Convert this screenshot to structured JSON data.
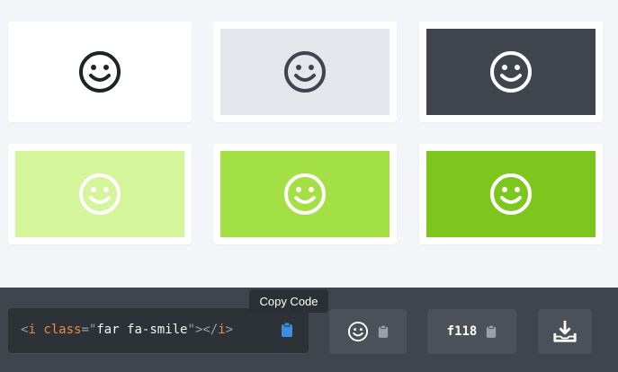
{
  "icon": {
    "name": "smile-icon",
    "html_code_parts": {
      "open": "<",
      "tag": "i",
      "space": " ",
      "attr": "class",
      "eq": "=",
      "q1": "\"",
      "value": "far fa-smile",
      "q2": "\"",
      "close": "></",
      "tag2": "i",
      "end": ">"
    },
    "unicode": "f118"
  },
  "tooltip": {
    "text": "Copy Code"
  },
  "swatches": [
    {
      "bg": "#ffffff",
      "icon": "#1f2328"
    },
    {
      "bg": "#e5e7ec",
      "icon": "#3f444d"
    },
    {
      "bg": "#3f444d",
      "icon": "#ffffff"
    },
    {
      "bg": "#d5f59a",
      "icon": "#ffffff"
    },
    {
      "bg": "#a2e043",
      "icon": "#ffffff"
    },
    {
      "bg": "#7cc61e",
      "icon": "#ffffff"
    }
  ],
  "colors": {
    "footer": "#3f444d",
    "code_bg": "#2d3138",
    "clipboard_active": "#3a8fe0",
    "clipboard_muted": "#9aa0a8"
  }
}
